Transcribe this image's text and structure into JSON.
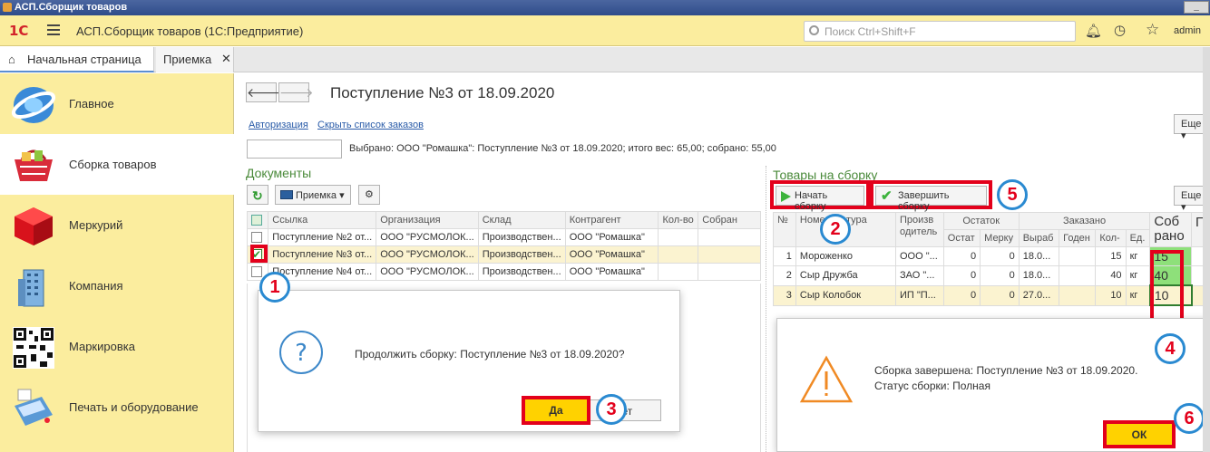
{
  "window": {
    "title": "АСП.Сборщик товаров",
    "minimize": "_"
  },
  "appbar": {
    "logo": "1С",
    "title": "АСП.Сборщик товаров  (1С:Предприятие)",
    "search_placeholder": "Поиск Ctrl+Shift+F",
    "user": "admin",
    "icons": [
      "menu-icon",
      "search-icon",
      "bell-icon",
      "history-icon",
      "star-icon"
    ]
  },
  "tabs": [
    {
      "label": "Начальная страница",
      "icon": "home-icon"
    },
    {
      "label": "Приемка",
      "close": "✕"
    }
  ],
  "sidebar": {
    "items": [
      {
        "label": "Главное",
        "icon": "globe-icon"
      },
      {
        "label": "Сборка товаров",
        "icon": "basket-icon"
      },
      {
        "label": "Меркурий",
        "icon": "cube-icon"
      },
      {
        "label": "Компания",
        "icon": "building-icon"
      },
      {
        "label": "Маркировка",
        "icon": "qr-code-icon"
      },
      {
        "label": "Печать и оборудование",
        "icon": "terminal-icon"
      }
    ]
  },
  "main": {
    "nav_back": "🡐",
    "nav_forward": "🡒",
    "title": "Поступление №3 от 18.09.2020",
    "link_auth": "Авторизация",
    "link_hide": "Скрыть список заказов",
    "more_label": "Еще ▾",
    "status_text": "Выбрано: ООО \"Ромашка\": Поступление №3 от 18.09.2020; итого вес: 65,00; собрано: 55,00"
  },
  "documents": {
    "title": "Документы",
    "filter_button": "Приемка ▾",
    "columns": [
      "Ссылка",
      "Организация",
      "Склад",
      "Контрагент",
      "Кол-во",
      "Собран"
    ],
    "rows": [
      {
        "link": "Поступление №2 от...",
        "org": "ООО \"РУСМОЛОК...",
        "warehouse": "Производствен...",
        "counterparty": "ООО \"Ромашка\"",
        "qty": "",
        "done": ""
      },
      {
        "link": "Поступление №3 от...",
        "org": "ООО \"РУСМОЛОК...",
        "warehouse": "Производствен...",
        "counterparty": "ООО \"Ромашка\"",
        "qty": "",
        "done": ""
      },
      {
        "link": "Поступление №4 от...",
        "org": "ООО \"РУСМОЛОК...",
        "warehouse": "Производствен...",
        "counterparty": "ООО \"Ромашка\"",
        "qty": "",
        "done": ""
      }
    ]
  },
  "goods": {
    "title": "Товары на сборку",
    "start_button": "Начать сборку",
    "finish_button": "Завершить сборку",
    "more_label": "Еще ▾",
    "head": {
      "num": "№",
      "name": "Номенклатура",
      "producer": "Произв одитель",
      "stock": "Остаток",
      "ordered": "Заказано",
      "collected": "Соб рано",
      "params": "Пар",
      "stock_rest": "Остат",
      "stock_merc": "Мерку",
      "ord_date": "Выраб",
      "ord_valid": "Годен",
      "ord_qty": "Кол-",
      "ord_unit": "Ед."
    },
    "rows": [
      {
        "n": "1",
        "name": "Мороженко",
        "producer": "ООО \"...",
        "rest": "0",
        "merc": "0",
        "date": "18.0...",
        "valid": "",
        "qty": "15",
        "unit": "кг",
        "collected": "15"
      },
      {
        "n": "2",
        "name": "Сыр Дружба",
        "producer": "ЗАО \"...",
        "rest": "0",
        "merc": "0",
        "date": "18.0...",
        "valid": "",
        "qty": "40",
        "unit": "кг",
        "collected": "40"
      },
      {
        "n": "3",
        "name": "Сыр Колобок",
        "producer": "ИП \"П...",
        "rest": "0",
        "merc": "0",
        "date": "27.0...",
        "valid": "",
        "qty": "10",
        "unit": "кг",
        "collected": "10"
      }
    ]
  },
  "dialog_confirm": {
    "icon": "question-icon",
    "text": "Продолжить сборку: Поступление №3 от 18.09.2020?",
    "yes": "Да",
    "no": "Нет"
  },
  "dialog_done": {
    "icon": "warning-icon",
    "line1": "Сборка завершена: Поступление №3 от 18.09.2020.",
    "line2": "Статус сборки: Полная",
    "ok": "ОК"
  },
  "markers": [
    "1",
    "2",
    "3",
    "4",
    "5",
    "6"
  ],
  "colors": {
    "accent_yellow": "#fbed9e",
    "marker_red": "#e3001b",
    "marker_blue": "#2a8ad1",
    "green_cell": "#8ee07a"
  }
}
